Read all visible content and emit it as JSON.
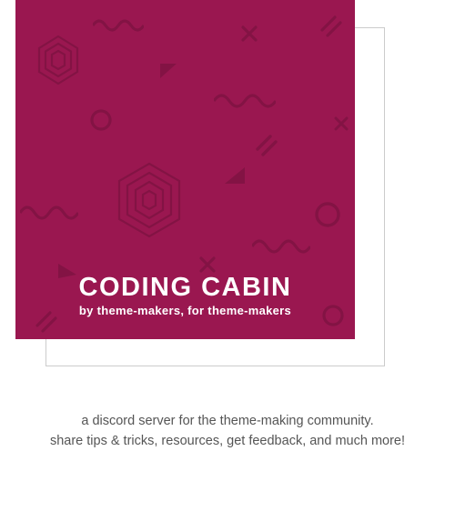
{
  "card": {
    "title": "CODING CABIN",
    "subtitle": "by theme-makers, for theme-makers"
  },
  "description": {
    "line1": "a discord server for the theme-making community.",
    "line2": "share tips & tricks, resources, get feedback, and much more!"
  },
  "colors": {
    "accent": "#9a1750",
    "text": "#555555"
  }
}
